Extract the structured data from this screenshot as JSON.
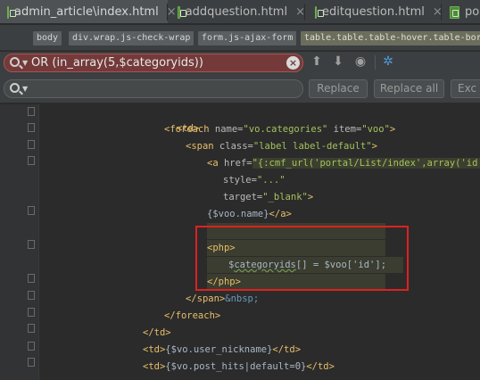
{
  "tabs": [
    {
      "label": "admin_article\\index.html",
      "close": "×",
      "active": true
    },
    {
      "label": "addquestion.html",
      "close": "×",
      "active": false
    },
    {
      "label": "editquestion.html",
      "close": "×",
      "active": false
    },
    {
      "label": "por",
      "close": "",
      "active": false
    }
  ],
  "breadcrumb": [
    "body",
    "div.wrap.js-check-wrap",
    "form.js-ajax-form",
    "table.table.table-hover.table-bor"
  ],
  "search": {
    "find_value": "OR (in_array(5,$categoryids))",
    "find_clear": "×",
    "replace_value": "",
    "replace_button": "Replace",
    "replace_all_button": "Replace all",
    "exclude_button": "Exc"
  },
  "toolbar_icons": [
    "arrow-up-icon",
    "arrow-down-icon",
    "find-occurrences-icon",
    "settings-icon"
  ],
  "code": {
    "l1": [
      "<td>"
    ],
    "l2_tag": "<foreach",
    "l2_a1": " name=",
    "l2_v1": "\"vo.categories\"",
    "l2_a2": " item=",
    "l2_v2": "\"voo\"",
    "l2_end": ">",
    "l3_tag": "<span",
    "l3_a1": " class=",
    "l3_v1": "\"label label-default\"",
    "l3_end": ">",
    "l4_tag": "<a",
    "l4_a1": " href=",
    "l4_v1": "\"{:cmf_url('portal/List/index',array('id'=>",
    "l5_a1": "style=",
    "l5_v1": "\"...\"",
    "l6_a1": "target=",
    "l6_v1": "\"_blank\"",
    "l6_end": ">",
    "l7_text": "{$voo.name}",
    "l7_tag": "</a>",
    "l8_blank": "",
    "l9_tag": "<php>",
    "l10_pre": "$",
    "l10_var": "categoryids",
    "l10_rest": "[] = $voo['id'];",
    "l11_tag": "</php>",
    "l12_tag": "</span>",
    "l12_ent": "&nbsp;",
    "l13_tag": "</foreach>",
    "l14_tag": "</td>",
    "l15_tag1": "<td>",
    "l15_text": "{$vo.user_nickname}",
    "l15_tag2": "</td>",
    "l16_tag1": "<td>",
    "l16_text": "{$vo.post_hits|default=0}",
    "l16_tag2": "</td>"
  },
  "colors": {
    "tag": "#e8bf6a",
    "string": "#a5c25c",
    "attr": "#bababa",
    "highlight_box": "#e02020"
  }
}
